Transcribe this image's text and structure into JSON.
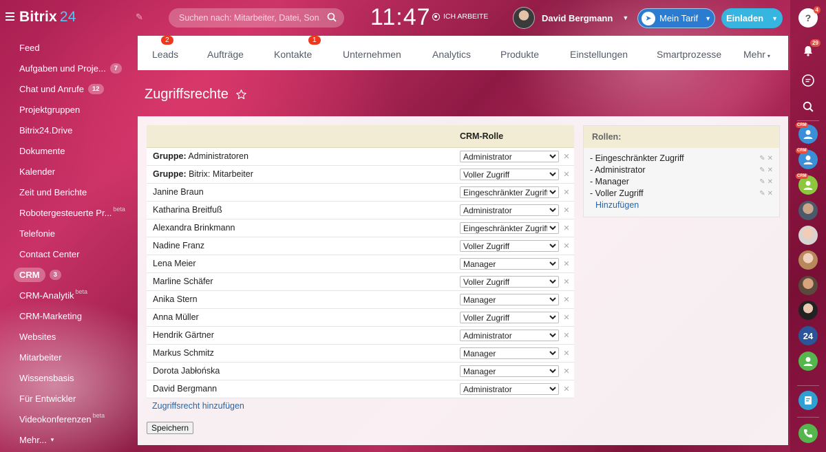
{
  "app": {
    "logo_text": "Bitrix",
    "logo_num": "24"
  },
  "search": {
    "placeholder": "Suchen nach: Mitarbeiter, Datei, Son..."
  },
  "clock": {
    "time": "11:47",
    "status": "ICH ARBEITE"
  },
  "user": {
    "name": "David Bergmann"
  },
  "buttons": {
    "tarif": "Mein Tarif",
    "invite": "Einladen"
  },
  "sidebar": {
    "items": [
      {
        "label": "Feed"
      },
      {
        "label": "Aufgaben und Proje...",
        "badge": "7"
      },
      {
        "label": "Chat und Anrufe",
        "badge": "12"
      },
      {
        "label": "Projektgruppen"
      },
      {
        "label": "Bitrix24.Drive"
      },
      {
        "label": "Dokumente"
      },
      {
        "label": "Kalender"
      },
      {
        "label": "Zeit und Berichte"
      },
      {
        "label": "Robotergesteuerte Pr...",
        "beta": "beta"
      },
      {
        "label": "Telefonie"
      },
      {
        "label": "Contact Center"
      },
      {
        "label": "CRM",
        "badge": "3",
        "active": true
      },
      {
        "label": "CRM-Analytik",
        "beta": "beta"
      },
      {
        "label": "CRM-Marketing"
      },
      {
        "label": "Websites"
      },
      {
        "label": "Mitarbeiter"
      },
      {
        "label": "Wissensbasis"
      },
      {
        "label": "Für Entwickler"
      },
      {
        "label": "Videokonferenzen",
        "beta": "beta"
      },
      {
        "label": "Mehr..."
      }
    ]
  },
  "tabs": [
    {
      "label": "Leads",
      "badge": "2"
    },
    {
      "label": "Aufträge"
    },
    {
      "label": "Kontakte",
      "badge": "1"
    },
    {
      "label": "Unternehmen"
    },
    {
      "label": "Analytics"
    },
    {
      "label": "Produkte"
    },
    {
      "label": "Einstellungen"
    },
    {
      "label": "Smartprozesse"
    },
    {
      "label": "Mehr"
    }
  ],
  "page": {
    "title": "Zugriffsrechte"
  },
  "table": {
    "header": "CRM-Rolle",
    "group_prefix": "Gruppe:",
    "rows": [
      {
        "group": true,
        "name": "Administratoren",
        "role": "Administrator"
      },
      {
        "group": true,
        "name": "Bitrix: Mitarbeiter",
        "role": "Voller Zugriff"
      },
      {
        "name": "Janine Braun",
        "role": "Eingeschränkter Zugriff"
      },
      {
        "name": "Katharina Breitfuß",
        "role": "Administrator"
      },
      {
        "name": "Alexandra Brinkmann",
        "role": "Eingeschränkter Zugriff"
      },
      {
        "name": "Nadine Franz",
        "role": "Voller Zugriff"
      },
      {
        "name": "Lena Meier",
        "role": "Manager"
      },
      {
        "name": "Marline Schäfer",
        "role": "Voller Zugriff"
      },
      {
        "name": "Anika Stern",
        "role": "Manager"
      },
      {
        "name": "Anna Müller",
        "role": "Voller Zugriff"
      },
      {
        "name": "Hendrik Gärtner",
        "role": "Administrator"
      },
      {
        "name": "Markus Schmitz",
        "role": "Manager"
      },
      {
        "name": "Dorota Jabłońska",
        "role": "Manager"
      },
      {
        "name": "David Bergmann",
        "role": "Administrator"
      }
    ],
    "add_link": "Zugriffsrecht hinzufügen",
    "save_label": "Speichern"
  },
  "roles_panel": {
    "title": "Rollen:",
    "roles": [
      "- Eingeschränkter Zugriff",
      "- Administrator",
      "- Manager",
      "- Voller Zugriff"
    ],
    "add_label": "Hinzufügen"
  },
  "role_options": [
    "Administrator",
    "Voller Zugriff",
    "Eingeschränkter Zugriff",
    "Manager"
  ],
  "rightbar": {
    "help_badge": "4",
    "notif_badge": "29",
    "crm_tag": "CRM",
    "badge_24": "24"
  },
  "colors": {
    "accent": "#2067b0",
    "badge_red": "#f0371b",
    "invite": "#36b5e0",
    "tarif": "#2b7bd0",
    "header_beige": "#f2ecd4"
  }
}
